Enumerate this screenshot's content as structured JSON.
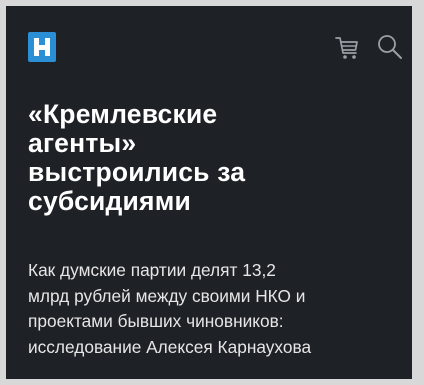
{
  "header": {
    "logo_icon": "newspaper-logo-icon",
    "cart_icon": "cart-icon",
    "search_icon": "search-icon"
  },
  "article": {
    "title_lines": [
      "«Кремлевские",
      "агенты»",
      "выстроились за",
      "субсидиями"
    ],
    "lead_lines": [
      "Как думские партии делят 13,2",
      "млрд рублей между своими НКО и",
      "проектами бывших чиновников:",
      "исследование Алексея Карнаухова"
    ]
  },
  "colors": {
    "background": "#1e2126",
    "logo": "#2b8fd6",
    "text": "#ffffff"
  }
}
